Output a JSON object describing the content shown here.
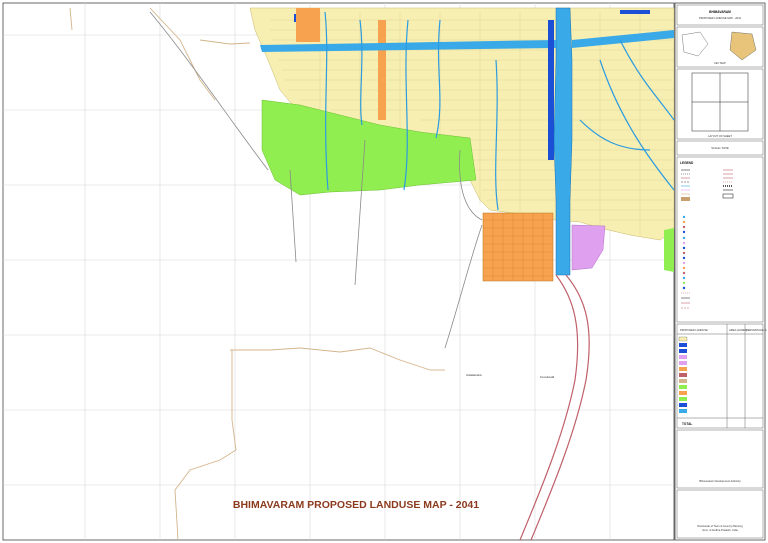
{
  "map_title": "BHIMAVARAM PROPOSED LANDUSE MAP - 2041",
  "colors": {
    "residential": "#f7efb2",
    "agriculture": "#90ee50",
    "industrial": "#f7a24f",
    "public_semi_public": "#e0a0f0",
    "water": "#3aa9e8",
    "commercial": "#1a4fd6",
    "railway": "#c0606a",
    "roads": "#d4b48a",
    "title": "#8b3a1e"
  },
  "panel": {
    "header_line1": "BHIMAVARAM",
    "header_line2": "PROPOSED LANDUSE MAP - 2041",
    "legend_title": "LEGEND",
    "landuse_table_header": "PROPOSED LANDUSE",
    "area_header": "AREA (ACRES)",
    "percent_header": "PERCENTAGE %",
    "total_label": "TOTAL",
    "authority_text": "Bhimavaram Development Authority",
    "footer_text1": "Directorate of Town & Country Planning",
    "footer_text2": "Govt. of Andhra Pradesh, India",
    "mapsheet_label": "LAYOUT OF SHEET",
    "scale_label": "SCALE / DATE",
    "key_map_label": "KEY MAP"
  },
  "place_labels": {
    "village1": "Gollalakoderu",
    "village2": "Kumudavalli"
  }
}
